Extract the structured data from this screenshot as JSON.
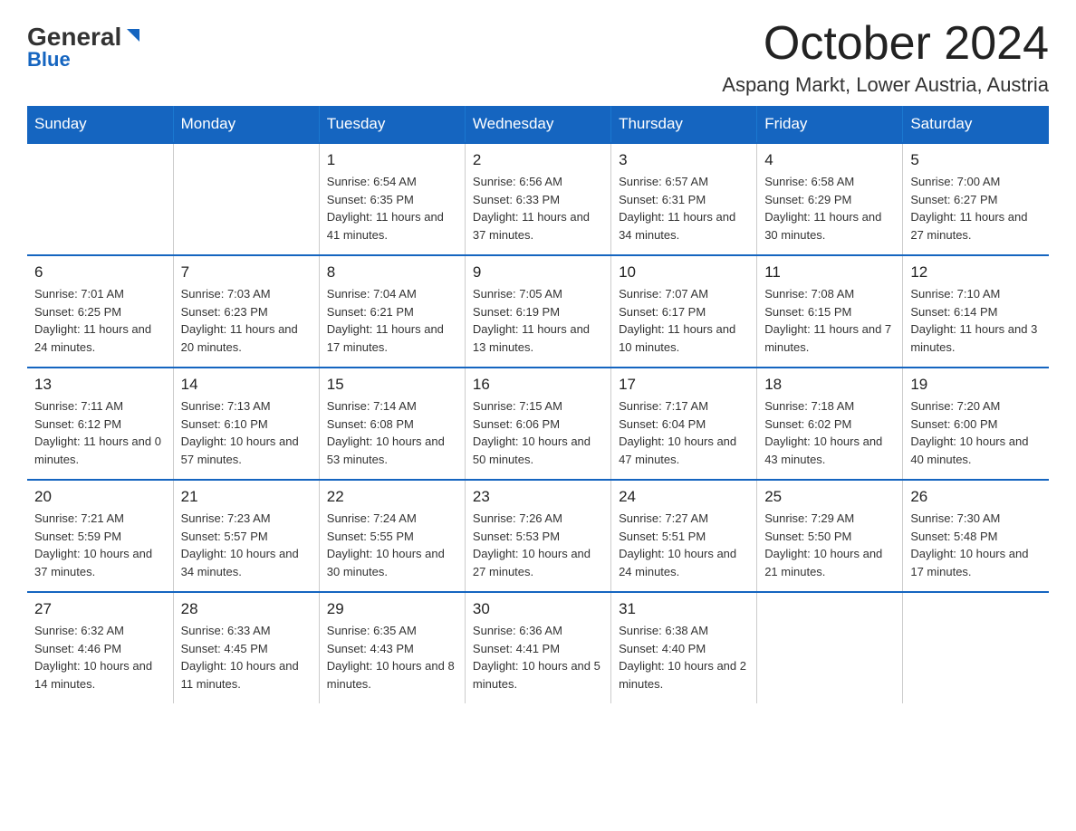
{
  "header": {
    "logo_general": "General",
    "logo_blue": "Blue",
    "month_title": "October 2024",
    "location": "Aspang Markt, Lower Austria, Austria"
  },
  "weekdays": [
    "Sunday",
    "Monday",
    "Tuesday",
    "Wednesday",
    "Thursday",
    "Friday",
    "Saturday"
  ],
  "weeks": [
    [
      {
        "day": "",
        "sunrise": "",
        "sunset": "",
        "daylight": ""
      },
      {
        "day": "",
        "sunrise": "",
        "sunset": "",
        "daylight": ""
      },
      {
        "day": "1",
        "sunrise": "Sunrise: 6:54 AM",
        "sunset": "Sunset: 6:35 PM",
        "daylight": "Daylight: 11 hours and 41 minutes."
      },
      {
        "day": "2",
        "sunrise": "Sunrise: 6:56 AM",
        "sunset": "Sunset: 6:33 PM",
        "daylight": "Daylight: 11 hours and 37 minutes."
      },
      {
        "day": "3",
        "sunrise": "Sunrise: 6:57 AM",
        "sunset": "Sunset: 6:31 PM",
        "daylight": "Daylight: 11 hours and 34 minutes."
      },
      {
        "day": "4",
        "sunrise": "Sunrise: 6:58 AM",
        "sunset": "Sunset: 6:29 PM",
        "daylight": "Daylight: 11 hours and 30 minutes."
      },
      {
        "day": "5",
        "sunrise": "Sunrise: 7:00 AM",
        "sunset": "Sunset: 6:27 PM",
        "daylight": "Daylight: 11 hours and 27 minutes."
      }
    ],
    [
      {
        "day": "6",
        "sunrise": "Sunrise: 7:01 AM",
        "sunset": "Sunset: 6:25 PM",
        "daylight": "Daylight: 11 hours and 24 minutes."
      },
      {
        "day": "7",
        "sunrise": "Sunrise: 7:03 AM",
        "sunset": "Sunset: 6:23 PM",
        "daylight": "Daylight: 11 hours and 20 minutes."
      },
      {
        "day": "8",
        "sunrise": "Sunrise: 7:04 AM",
        "sunset": "Sunset: 6:21 PM",
        "daylight": "Daylight: 11 hours and 17 minutes."
      },
      {
        "day": "9",
        "sunrise": "Sunrise: 7:05 AM",
        "sunset": "Sunset: 6:19 PM",
        "daylight": "Daylight: 11 hours and 13 minutes."
      },
      {
        "day": "10",
        "sunrise": "Sunrise: 7:07 AM",
        "sunset": "Sunset: 6:17 PM",
        "daylight": "Daylight: 11 hours and 10 minutes."
      },
      {
        "day": "11",
        "sunrise": "Sunrise: 7:08 AM",
        "sunset": "Sunset: 6:15 PM",
        "daylight": "Daylight: 11 hours and 7 minutes."
      },
      {
        "day": "12",
        "sunrise": "Sunrise: 7:10 AM",
        "sunset": "Sunset: 6:14 PM",
        "daylight": "Daylight: 11 hours and 3 minutes."
      }
    ],
    [
      {
        "day": "13",
        "sunrise": "Sunrise: 7:11 AM",
        "sunset": "Sunset: 6:12 PM",
        "daylight": "Daylight: 11 hours and 0 minutes."
      },
      {
        "day": "14",
        "sunrise": "Sunrise: 7:13 AM",
        "sunset": "Sunset: 6:10 PM",
        "daylight": "Daylight: 10 hours and 57 minutes."
      },
      {
        "day": "15",
        "sunrise": "Sunrise: 7:14 AM",
        "sunset": "Sunset: 6:08 PM",
        "daylight": "Daylight: 10 hours and 53 minutes."
      },
      {
        "day": "16",
        "sunrise": "Sunrise: 7:15 AM",
        "sunset": "Sunset: 6:06 PM",
        "daylight": "Daylight: 10 hours and 50 minutes."
      },
      {
        "day": "17",
        "sunrise": "Sunrise: 7:17 AM",
        "sunset": "Sunset: 6:04 PM",
        "daylight": "Daylight: 10 hours and 47 minutes."
      },
      {
        "day": "18",
        "sunrise": "Sunrise: 7:18 AM",
        "sunset": "Sunset: 6:02 PM",
        "daylight": "Daylight: 10 hours and 43 minutes."
      },
      {
        "day": "19",
        "sunrise": "Sunrise: 7:20 AM",
        "sunset": "Sunset: 6:00 PM",
        "daylight": "Daylight: 10 hours and 40 minutes."
      }
    ],
    [
      {
        "day": "20",
        "sunrise": "Sunrise: 7:21 AM",
        "sunset": "Sunset: 5:59 PM",
        "daylight": "Daylight: 10 hours and 37 minutes."
      },
      {
        "day": "21",
        "sunrise": "Sunrise: 7:23 AM",
        "sunset": "Sunset: 5:57 PM",
        "daylight": "Daylight: 10 hours and 34 minutes."
      },
      {
        "day": "22",
        "sunrise": "Sunrise: 7:24 AM",
        "sunset": "Sunset: 5:55 PM",
        "daylight": "Daylight: 10 hours and 30 minutes."
      },
      {
        "day": "23",
        "sunrise": "Sunrise: 7:26 AM",
        "sunset": "Sunset: 5:53 PM",
        "daylight": "Daylight: 10 hours and 27 minutes."
      },
      {
        "day": "24",
        "sunrise": "Sunrise: 7:27 AM",
        "sunset": "Sunset: 5:51 PM",
        "daylight": "Daylight: 10 hours and 24 minutes."
      },
      {
        "day": "25",
        "sunrise": "Sunrise: 7:29 AM",
        "sunset": "Sunset: 5:50 PM",
        "daylight": "Daylight: 10 hours and 21 minutes."
      },
      {
        "day": "26",
        "sunrise": "Sunrise: 7:30 AM",
        "sunset": "Sunset: 5:48 PM",
        "daylight": "Daylight: 10 hours and 17 minutes."
      }
    ],
    [
      {
        "day": "27",
        "sunrise": "Sunrise: 6:32 AM",
        "sunset": "Sunset: 4:46 PM",
        "daylight": "Daylight: 10 hours and 14 minutes."
      },
      {
        "day": "28",
        "sunrise": "Sunrise: 6:33 AM",
        "sunset": "Sunset: 4:45 PM",
        "daylight": "Daylight: 10 hours and 11 minutes."
      },
      {
        "day": "29",
        "sunrise": "Sunrise: 6:35 AM",
        "sunset": "Sunset: 4:43 PM",
        "daylight": "Daylight: 10 hours and 8 minutes."
      },
      {
        "day": "30",
        "sunrise": "Sunrise: 6:36 AM",
        "sunset": "Sunset: 4:41 PM",
        "daylight": "Daylight: 10 hours and 5 minutes."
      },
      {
        "day": "31",
        "sunrise": "Sunrise: 6:38 AM",
        "sunset": "Sunset: 4:40 PM",
        "daylight": "Daylight: 10 hours and 2 minutes."
      },
      {
        "day": "",
        "sunrise": "",
        "sunset": "",
        "daylight": ""
      },
      {
        "day": "",
        "sunrise": "",
        "sunset": "",
        "daylight": ""
      }
    ]
  ]
}
